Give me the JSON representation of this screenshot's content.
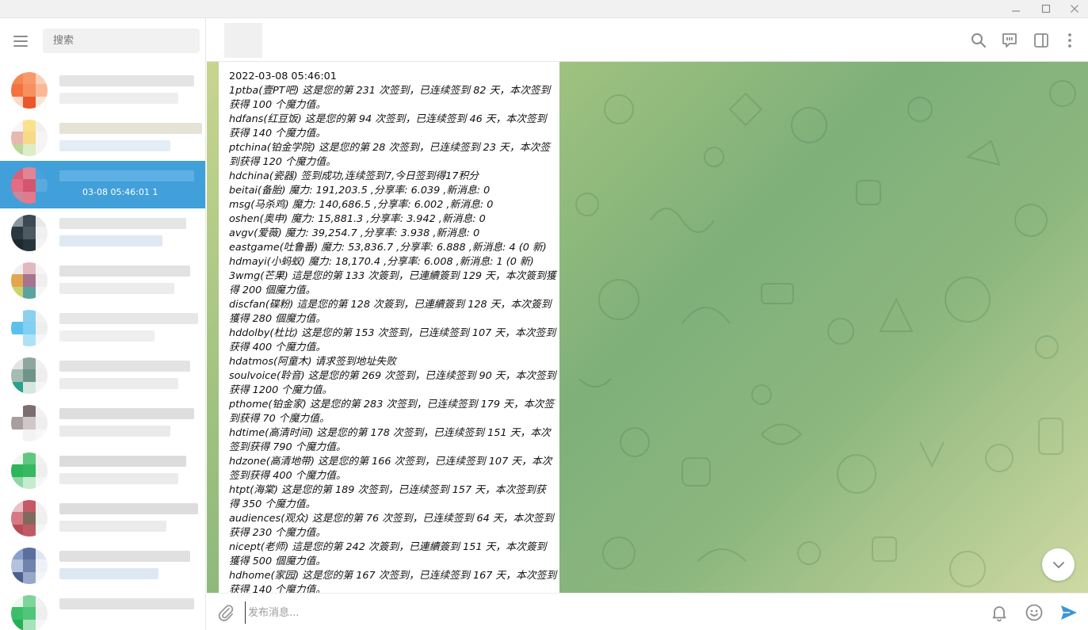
{
  "window": {
    "minimize": "—",
    "maximize": "☐",
    "close": "✕"
  },
  "sidebar": {
    "search_placeholder": "搜索",
    "active_chat_time": "03-08 05:46:01 1"
  },
  "message": {
    "lines": [
      "2022-03-08 05:46:01",
      "1ptba(壹PT吧) 这是您的第 231 次签到，已连续签到 82 天，本次签到",
      "获得 100 个魔力值。",
      "hdfans(红豆饭) 这是您的第 94 次签到，已连续签到 46 天，本次签到",
      "获得 140 个魔力值。",
      "ptchina(铂金学院) 这是您的第 28 次签到，已连续签到 23 天，本次签",
      "到获得 120 个魔力值。",
      "hdchina(瓷器) 签到成功,连续签到7,今日签到得17积分",
      "beitai(备胎) 魔力: 191,203.5 ,分享率: 6.039 ,新消息: 0",
      "msg(马杀鸡) 魔力: 140,686.5 ,分享率: 6.002 ,新消息: 0",
      "oshen(奥申) 魔力: 15,881.3 ,分享率: 3.942 ,新消息: 0",
      "avgv(爱薇) 魔力: 39,254.7 ,分享率: 3.938 ,新消息: 0",
      "eastgame(吐鲁番) 魔力: 53,836.7 ,分享率: 6.888 ,新消息: 4 (0 新)",
      "hdmayi(小蚂蚁) 魔力: 18,170.4 ,分享率: 6.008 ,新消息: 1 (0 新)",
      "3wmg(芒果) 這是您的第 133 次簽到，已連續簽到 129 天，本次簽到獲",
      "得 200 個魔力值。",
      "discfan(碟粉) 這是您的第 128 次簽到，已連續簽到 128 天，本次簽到",
      "獲得 280 個魔力值。",
      "hddolby(杜比) 这是您的第 153 次签到，已连续签到 107 天，本次签到",
      "获得 400 个魔力值。",
      "hdatmos(阿童木) 请求签到地址失败",
      "soulvoice(聆音) 这是您的第 269 次签到，已连续签到 90 天，本次签到",
      "获得 1200 个魔力值。",
      "pthome(铂金家) 这是您的第 283 次签到，已连续签到 179 天，本次签",
      "到获得 70 个魔力值。",
      "hdtime(高清时间) 这是您的第 178 次签到，已连续签到 151 天，本次",
      "签到获得 790 个魔力值。",
      "hdzone(高清地带) 这是您的第 166 次签到，已连续签到 107 天，本次",
      "签到获得 400 个魔力值。",
      "htpt(海棠) 这是您的第 189 次签到，已连续签到 157 天，本次签到获",
      "得 350 个魔力值。",
      "audiences(观众) 这是您的第 76 次签到，已连续签到 64 天，本次签到",
      "获得 230 个魔力值。",
      "nicept(老师) 這是您的第 242 次簽到，已連續簽到 151 天，本次簽到",
      "獲得 500 個魔力值。",
      "hdhome(家园) 这是您的第 167 次签到，已连续签到 167 天，本次签到",
      "获得 140 个魔力值。"
    ]
  },
  "composer": {
    "placeholder": "发布消息..."
  },
  "colors": {
    "accent": "#419fd9",
    "send": "#3a95d8"
  },
  "icons": [
    "menu-icon",
    "search-icon",
    "topic-icon",
    "side-panel-icon",
    "more-icon",
    "chevron-down-icon",
    "paperclip-icon",
    "bell-icon",
    "emoji-icon",
    "send-icon"
  ]
}
